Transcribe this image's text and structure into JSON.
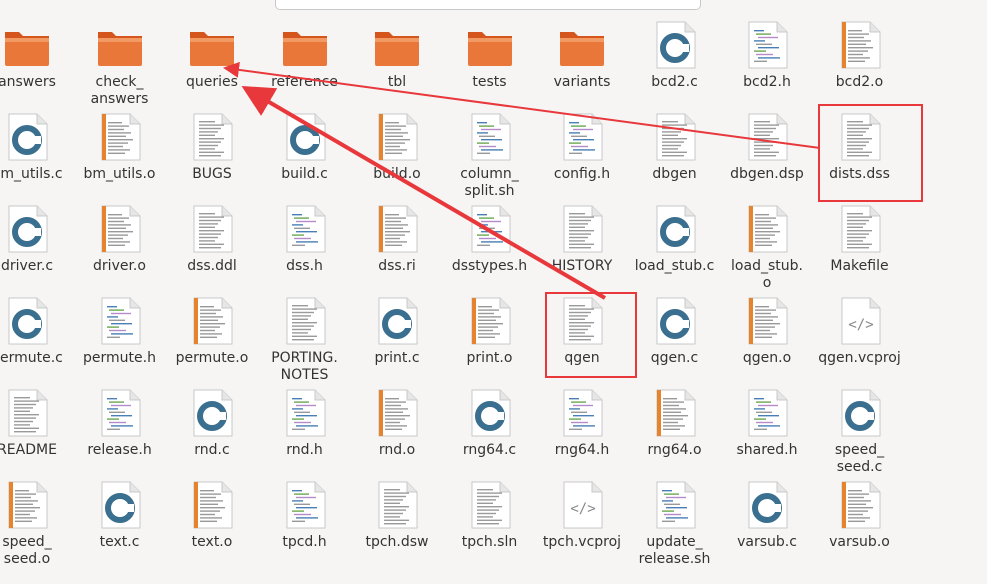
{
  "window": {
    "title": "",
    "search_placeholder": ""
  },
  "files": [
    {
      "name": "answers",
      "type": "folder"
    },
    {
      "name": "check_\nanswers",
      "type": "folder"
    },
    {
      "name": "queries",
      "type": "folder"
    },
    {
      "name": "reference",
      "type": "folder"
    },
    {
      "name": "tbl",
      "type": "folder"
    },
    {
      "name": "tests",
      "type": "folder"
    },
    {
      "name": "variants",
      "type": "folder"
    },
    {
      "name": "bcd2.c",
      "type": "c"
    },
    {
      "name": "bcd2.h",
      "type": "h"
    },
    {
      "name": "bcd2.o",
      "type": "o"
    },
    {
      "name": "bm_utils.c",
      "type": "c"
    },
    {
      "name": "bm_utils.o",
      "type": "o"
    },
    {
      "name": "BUGS",
      "type": "text"
    },
    {
      "name": "build.c",
      "type": "c"
    },
    {
      "name": "build.o",
      "type": "o"
    },
    {
      "name": "column_\nsplit.sh",
      "type": "script"
    },
    {
      "name": "config.h",
      "type": "h"
    },
    {
      "name": "dbgen",
      "type": "text"
    },
    {
      "name": "dbgen.dsp",
      "type": "text"
    },
    {
      "name": "dists.dss",
      "type": "text"
    },
    {
      "name": "driver.c",
      "type": "c"
    },
    {
      "name": "driver.o",
      "type": "o"
    },
    {
      "name": "dss.ddl",
      "type": "text"
    },
    {
      "name": "dss.h",
      "type": "h"
    },
    {
      "name": "dss.ri",
      "type": "o"
    },
    {
      "name": "dsstypes.h",
      "type": "h"
    },
    {
      "name": "HISTORY",
      "type": "text"
    },
    {
      "name": "load_stub.c",
      "type": "c"
    },
    {
      "name": "load_stub.\no",
      "type": "o"
    },
    {
      "name": "Makefile",
      "type": "text"
    },
    {
      "name": "permute.c",
      "type": "c"
    },
    {
      "name": "permute.h",
      "type": "h"
    },
    {
      "name": "permute.o",
      "type": "o"
    },
    {
      "name": "PORTING.\nNOTES",
      "type": "text"
    },
    {
      "name": "print.c",
      "type": "c"
    },
    {
      "name": "print.o",
      "type": "o"
    },
    {
      "name": "qgen",
      "type": "text"
    },
    {
      "name": "qgen.c",
      "type": "c"
    },
    {
      "name": "qgen.o",
      "type": "o"
    },
    {
      "name": "qgen.vcproj",
      "type": "xml"
    },
    {
      "name": "README",
      "type": "text"
    },
    {
      "name": "release.h",
      "type": "h"
    },
    {
      "name": "rnd.c",
      "type": "c"
    },
    {
      "name": "rnd.h",
      "type": "h"
    },
    {
      "name": "rnd.o",
      "type": "o"
    },
    {
      "name": "rng64.c",
      "type": "c"
    },
    {
      "name": "rng64.h",
      "type": "h"
    },
    {
      "name": "rng64.o",
      "type": "o"
    },
    {
      "name": "shared.h",
      "type": "h"
    },
    {
      "name": "speed_\nseed.c",
      "type": "c"
    },
    {
      "name": "speed_\nseed.o",
      "type": "o"
    },
    {
      "name": "text.c",
      "type": "c"
    },
    {
      "name": "text.o",
      "type": "o"
    },
    {
      "name": "tpcd.h",
      "type": "h"
    },
    {
      "name": "tpch.dsw",
      "type": "text"
    },
    {
      "name": "tpch.sln",
      "type": "text"
    },
    {
      "name": "tpch.vcproj",
      "type": "xml"
    },
    {
      "name": "update_\nrelease.sh",
      "type": "script"
    },
    {
      "name": "varsub.c",
      "type": "c"
    },
    {
      "name": "varsub.o",
      "type": "o"
    }
  ],
  "annotations": {
    "highlighted": [
      "dists.dss",
      "qgen"
    ],
    "arrow_target": "queries",
    "color": "#e8383b"
  },
  "colors": {
    "folder": "#e9773a",
    "folder_dark": "#d4561c",
    "c_ring": "#3a6f8f",
    "doc_bg": "#ffffff",
    "orange_strip": "#e6832e"
  }
}
